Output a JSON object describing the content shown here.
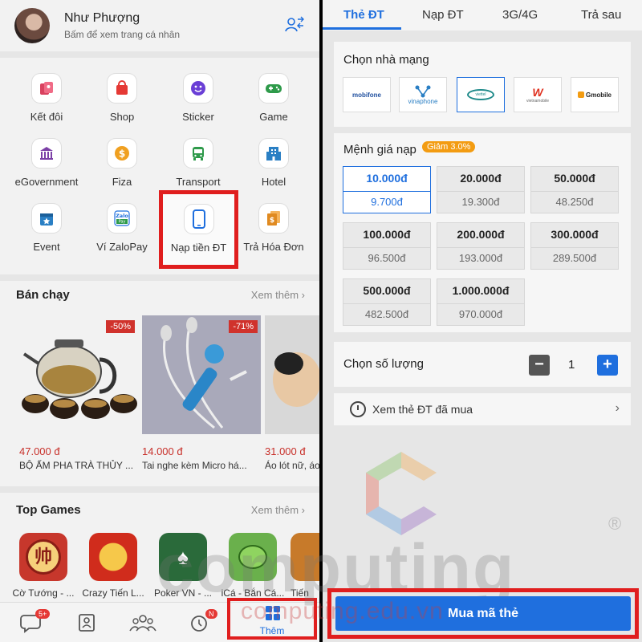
{
  "left": {
    "profile": {
      "name": "Như Phượng",
      "subtitle": "Bấm để xem trang cá nhân"
    },
    "grid": [
      {
        "label": "Kết đôi",
        "icon": "match-icon",
        "color": "#d9425f"
      },
      {
        "label": "Shop",
        "icon": "shop-bag-icon",
        "color": "#e53935"
      },
      {
        "label": "Sticker",
        "icon": "sticker-icon",
        "color": "#6a3fd6"
      },
      {
        "label": "Game",
        "icon": "gamepad-icon",
        "color": "#2e9a4a"
      },
      {
        "label": "eGovernment",
        "icon": "government-icon",
        "color": "#7b3fa6"
      },
      {
        "label": "Fiza",
        "icon": "fiza-coin-icon",
        "color": "#f0a020"
      },
      {
        "label": "Transport",
        "icon": "bus-icon",
        "color": "#2e9a4a"
      },
      {
        "label": "Hotel",
        "icon": "hotel-icon",
        "color": "#2a7fc4"
      },
      {
        "label": "Event",
        "icon": "calendar-star-icon",
        "color": "#2a7fc4"
      },
      {
        "label": "Ví ZaloPay",
        "icon": "zalopay-icon",
        "color": "#1f6fde"
      },
      {
        "label": "Nạp tiền ĐT",
        "icon": "phone-icon",
        "color": "#1f6fde"
      },
      {
        "label": "Trả Hóa Đơn",
        "icon": "bill-icon",
        "color": "#e08a20"
      }
    ],
    "bestseller": {
      "title": "Bán chạy",
      "more": "Xem thêm",
      "products": [
        {
          "price": "47.000 đ",
          "name": "BỘ ẤM PHA TRÀ THỦY ...",
          "badge": "-50%"
        },
        {
          "price": "14.000 đ",
          "name": "Tai nghe kèm Micro há...",
          "badge": "-71%"
        },
        {
          "price": "31.000 đ",
          "name": "Áo lót nữ, áo",
          "badge": ""
        }
      ]
    },
    "games": {
      "title": "Top Games",
      "more": "Xem thêm",
      "items": [
        {
          "label": "Cờ Tướng - ..."
        },
        {
          "label": "Crazy Tiến L..."
        },
        {
          "label": "Poker VN - ..."
        },
        {
          "label": "iCá - Bắn Cá..."
        },
        {
          "label": "Tiến"
        }
      ]
    },
    "nav": {
      "chat_badge": "5+",
      "clock_badge": "N",
      "more_label": "Thêm"
    }
  },
  "right": {
    "tabs": [
      "Thẻ ĐT",
      "Nạp ĐT",
      "3G/4G",
      "Trả sau"
    ],
    "carrier_title": "Chọn nhà mạng",
    "carriers": [
      "mobifone",
      "vinaphone",
      "viettel",
      "vietnamobile",
      "Gmobile"
    ],
    "denom_title": "Mệnh giá nạp",
    "discount": "Giảm 3.0%",
    "denominations": [
      {
        "face": "10.000đ",
        "price": "9.700đ"
      },
      {
        "face": "20.000đ",
        "price": "19.300đ"
      },
      {
        "face": "50.000đ",
        "price": "48.250đ"
      },
      {
        "face": "100.000đ",
        "price": "96.500đ"
      },
      {
        "face": "200.000đ",
        "price": "193.000đ"
      },
      {
        "face": "300.000đ",
        "price": "289.500đ"
      },
      {
        "face": "500.000đ",
        "price": "482.500đ"
      },
      {
        "face": "1.000.000đ",
        "price": "970.000đ"
      }
    ],
    "quantity_title": "Chọn số lượng",
    "quantity": "1",
    "history_label": "Xem thẻ ĐT đã mua",
    "buy_label": "Mua mã thẻ"
  },
  "watermark": {
    "brand": "computing",
    "url": "computing.edu.vn",
    "reg": "®"
  },
  "colors": {
    "accent": "#1f6fde",
    "highlight": "#e01e1e",
    "price": "#c8302a"
  }
}
